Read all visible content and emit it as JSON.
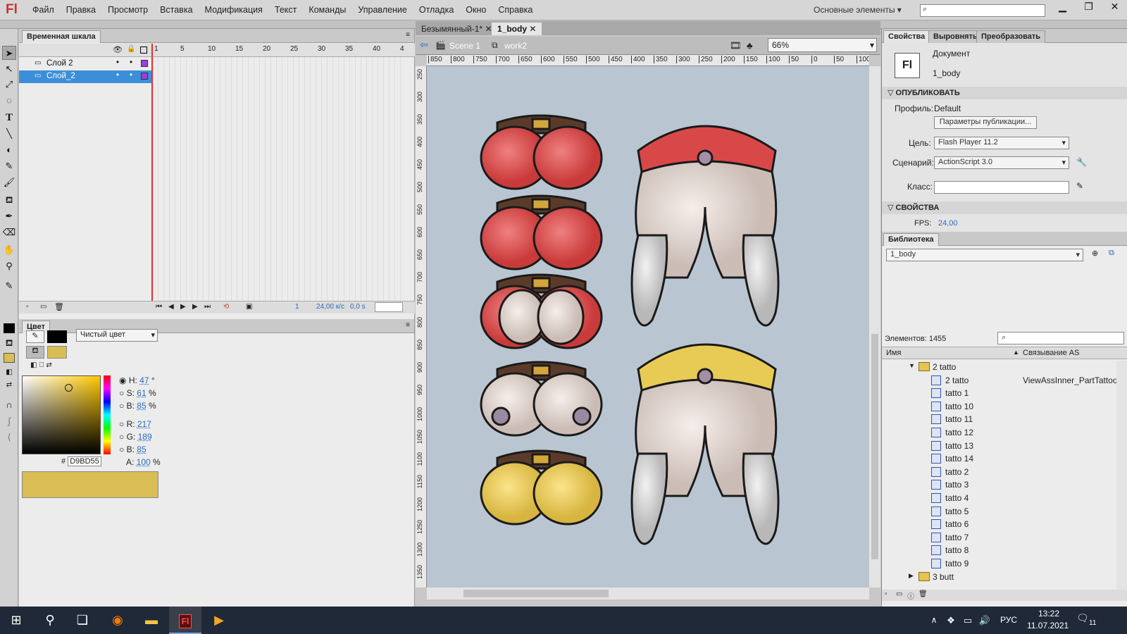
{
  "app": {
    "logo": "Fl",
    "menu": [
      "Файл",
      "Правка",
      "Просмотр",
      "Вставка",
      "Модификация",
      "Текст",
      "Команды",
      "Управление",
      "Отладка",
      "Окно",
      "Справка"
    ],
    "workspace": "Основные элементы ▾"
  },
  "timeline": {
    "title": "Временная шкала",
    "layers": [
      {
        "name": "Слой 2",
        "selected": false
      },
      {
        "name": "Слой_2",
        "selected": true
      }
    ],
    "frame_numbers": [
      "1",
      "5",
      "10",
      "15",
      "20",
      "25",
      "30",
      "35",
      "40",
      "4"
    ],
    "status": {
      "frame": "1",
      "fps": "24,00 к/с",
      "time": "0,0 s"
    }
  },
  "color": {
    "title": "Цвет",
    "fill_type": "Чистый цвет",
    "h": "47",
    "s": "61",
    "b": "85",
    "r": "217",
    "g": "189",
    "bv": "85",
    "a": "100",
    "hex": "D9BD55",
    "swatch": "#D9BD55",
    "deg": "°",
    "pct": "%"
  },
  "doc": {
    "tabs": [
      "Безымянный-1*",
      "1_body"
    ],
    "scene": "Scene 1",
    "symbol": "work2",
    "zoom": "66%",
    "ruler_top": [
      "850",
      "800",
      "750",
      "700",
      "650",
      "600",
      "550",
      "500",
      "450",
      "400",
      "350",
      "300",
      "250",
      "200",
      "150",
      "100",
      "50",
      "0",
      "50",
      "100"
    ],
    "ruler_left": [
      "250",
      "300",
      "350",
      "400",
      "450",
      "500",
      "550",
      "600",
      "650",
      "700",
      "750",
      "800",
      "850",
      "900",
      "950",
      "1000",
      "1050",
      "1100",
      "1150",
      "1200",
      "1250",
      "1300",
      "1350"
    ]
  },
  "props": {
    "tabs": [
      "Свойства",
      "Выровнять",
      "Преобразовать"
    ],
    "doc_label": "Документ",
    "doc_name": "1_body",
    "publish": "ОПУБЛИКОВАТЬ",
    "profile_label": "Профиль:",
    "profile": "Default",
    "publish_btn": "Параметры публикации...",
    "target_label": "Цель:",
    "target": "Flash Player 11.2",
    "script_label": "Сценарий:",
    "script": "ActionScript 3.0",
    "class_label": "Класс:",
    "properties": "СВОЙСТВА",
    "fps_label": "FPS:",
    "fps": "24,00"
  },
  "library": {
    "title": "Библиотека",
    "doc": "1_body",
    "count": "Элементов: 1455",
    "col_name": "Имя",
    "col_link": "Связывание AS",
    "items": [
      {
        "name": "2 tatto",
        "type": "folder",
        "link": ""
      },
      {
        "name": "2 tatto",
        "type": "symbol",
        "link": "ViewAssInner_PartTattoo"
      },
      {
        "name": "tatto 1",
        "type": "symbol",
        "link": ""
      },
      {
        "name": "tatto 10",
        "type": "symbol",
        "link": ""
      },
      {
        "name": "tatto 11",
        "type": "symbol",
        "link": ""
      },
      {
        "name": "tatto 12",
        "type": "symbol",
        "link": ""
      },
      {
        "name": "tatto 13",
        "type": "symbol",
        "link": ""
      },
      {
        "name": "tatto 14",
        "type": "symbol",
        "link": ""
      },
      {
        "name": "tatto 2",
        "type": "symbol",
        "link": ""
      },
      {
        "name": "tatto 3",
        "type": "symbol",
        "link": ""
      },
      {
        "name": "tatto 4",
        "type": "symbol",
        "link": ""
      },
      {
        "name": "tatto 5",
        "type": "symbol",
        "link": ""
      },
      {
        "name": "tatto 6",
        "type": "symbol",
        "link": ""
      },
      {
        "name": "tatto 7",
        "type": "symbol",
        "link": ""
      },
      {
        "name": "tatto 8",
        "type": "symbol",
        "link": ""
      },
      {
        "name": "tatto 9",
        "type": "symbol",
        "link": ""
      },
      {
        "name": "3 butt",
        "type": "folder",
        "link": ""
      }
    ]
  },
  "taskbar": {
    "lang": "РУС",
    "time": "13:22",
    "date": "11.07.2021",
    "notifications": "11"
  }
}
